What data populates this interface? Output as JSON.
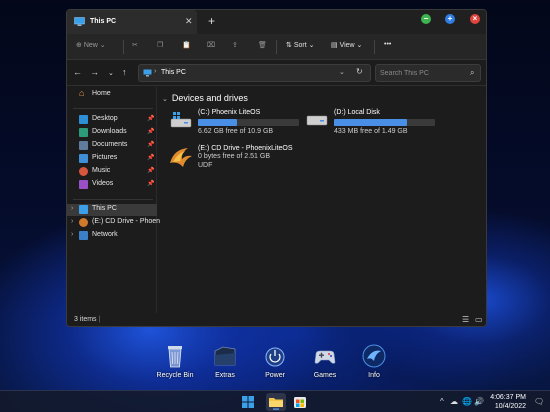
{
  "window": {
    "tab_title": "This PC",
    "tab_close": "✕",
    "new_tab": "+",
    "buttons": {
      "minimize": "−",
      "maximize": "+",
      "close": "×"
    }
  },
  "toolbar": {
    "new_label": "New",
    "sort_label": "Sort",
    "view_label": "View",
    "more_label": "•••"
  },
  "address": {
    "breadcrumb": "This PC",
    "search_placeholder": "Search This PC"
  },
  "sidebar": {
    "items": [
      {
        "label": "Home"
      },
      {
        "label": "Desktop"
      },
      {
        "label": "Downloads"
      },
      {
        "label": "Documents"
      },
      {
        "label": "Pictures"
      },
      {
        "label": "Music"
      },
      {
        "label": "Videos"
      },
      {
        "label": "This PC"
      },
      {
        "label": "(E:) CD Drive - Phoen"
      },
      {
        "label": "Network"
      }
    ]
  },
  "main": {
    "section_title": "Devices and drives",
    "drives": [
      {
        "name": "(C:) Phoenix LiteOS",
        "free_text": "6.62 GB free of 10.9 GB",
        "used_fraction": 0.39
      },
      {
        "name": "(D:) Local Disk",
        "free_text": "433 MB free of 1.49 GB",
        "used_fraction": 0.72
      },
      {
        "name": "(E:) CD Drive - PhoenixLiteOS",
        "free_text": "0 bytes free of 2.51 GB",
        "fs": "UDF"
      }
    ]
  },
  "status": {
    "count": "3 items"
  },
  "desktop_icons": [
    {
      "label": "Recycle Bin"
    },
    {
      "label": "Extras"
    },
    {
      "label": "Power"
    },
    {
      "label": "Games"
    },
    {
      "label": "Info"
    }
  ],
  "taskbar": {
    "time": "4:06:37 PM",
    "date": "10/4/2022"
  },
  "colors": {
    "accent": "#4a8fe6",
    "window_bg": "#1c1c1c",
    "min": "#3fb34f",
    "max": "#2f7de1",
    "close": "#e0443a"
  }
}
